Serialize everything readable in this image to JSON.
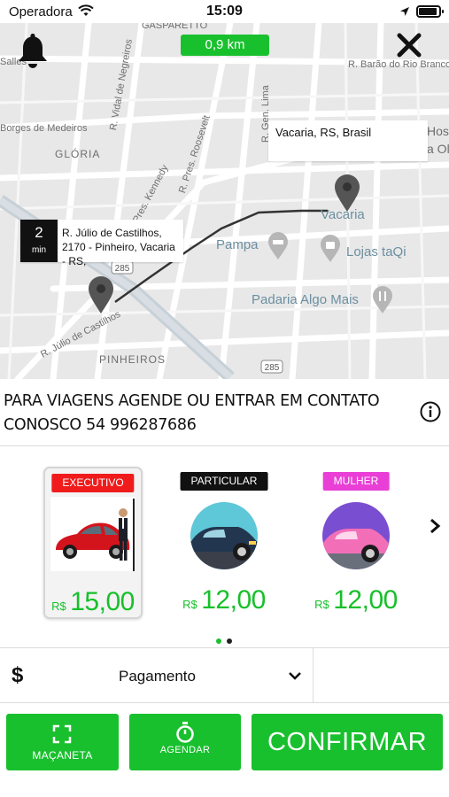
{
  "status_bar": {
    "carrier": "Operadora",
    "time": "15:09",
    "icons": [
      "wifi-icon",
      "location-arrow-icon",
      "battery-icon"
    ]
  },
  "map": {
    "distance": "0,9 km",
    "destination_label": "Vacaria, RS, Brasil",
    "eta": {
      "value": "2",
      "unit": "min"
    },
    "origin_address": "R. Júlio de Castilhos, 2170 - Pinheiro, Vacaria - RS,",
    "street_labels": [
      "GASPARETTO",
      "Salles",
      "R. Barão do Rio Branco",
      "Borges de Medeiros",
      "R. Vidal de Negreiros",
      "R. Gen. Lima",
      "R. Pres. Roosevelt",
      "Pres. Kennedy",
      "GLÓRIA",
      "285",
      "R. Júlio de Castilhos",
      "PINHEIROS",
      "285",
      "Hosp",
      "a Oli"
    ],
    "poi_labels": [
      "Vacaria",
      "Pampa",
      "Lojas taQi",
      "Padaria Algo Mais"
    ]
  },
  "notice": "PARA VIAGENS AGENDE OU ENTRAR EM CONTATO CONOSCO 54 996287686",
  "options": [
    {
      "badge": "EXECUTIVO",
      "badge_color": "#f01c1c",
      "currency": "R$",
      "price": "15,00",
      "selected": true
    },
    {
      "badge": "PARTICULAR",
      "badge_color": "#111111",
      "currency": "R$",
      "price": "12,00",
      "selected": false
    },
    {
      "badge": "MULHER",
      "badge_color": "#e93fd6",
      "currency": "R$",
      "price": "12,00",
      "selected": false
    }
  ],
  "payment": {
    "symbol": "$",
    "label": "Pagamento"
  },
  "buttons": {
    "macaneta": "MAÇANETA",
    "agendar": "AGENDAR",
    "confirm": "CONFIRMAR"
  },
  "colors": {
    "accent": "#19c02e",
    "price": "#16c02a"
  }
}
